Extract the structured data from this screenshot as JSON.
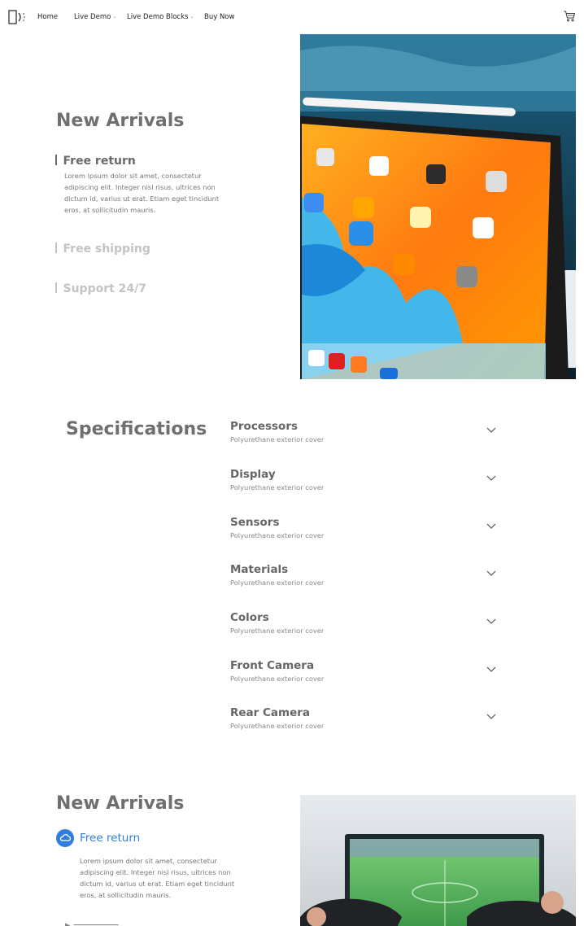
{
  "nav": {
    "items": [
      {
        "label": "Home"
      },
      {
        "label": "Live Demo"
      },
      {
        "label": "Live Demo Blocks"
      },
      {
        "label": "Buy Now"
      }
    ],
    "chevron": "⌄"
  },
  "hero1": {
    "title": "New Arrivals",
    "features": [
      {
        "label": "Free return"
      },
      {
        "label": "Free shipping"
      },
      {
        "label": "Support 24/7"
      }
    ],
    "description": "Lorem ipsum dolor sit amet, consectetur adipiscing elit. Integer nisl risus, ultrices non dictum id, varius ut erat. Etiam eget tincidunt eros, at sollicitudin mauris.",
    "active_feature_index": 0
  },
  "specs": {
    "title": "Specifications",
    "items": [
      {
        "title": "Processors",
        "subtitle": "Polyurethane exterior cover"
      },
      {
        "title": "Display",
        "subtitle": "Polyurethane exterior cover"
      },
      {
        "title": "Sensors",
        "subtitle": "Polyurethane exterior cover"
      },
      {
        "title": "Materials",
        "subtitle": "Polyurethane exterior cover"
      },
      {
        "title": "Colors",
        "subtitle": "Polyurethane exterior cover"
      },
      {
        "title": "Front Camera",
        "subtitle": "Polyurethane exterior cover"
      },
      {
        "title": "Rear Camera",
        "subtitle": "Polyurethane exterior cover"
      }
    ]
  },
  "hero2": {
    "title": "New Arrivals",
    "feature_label": "Free return",
    "description": "Lorem ipsum dolor sit amet, consectetur adipiscing elit. Integer nisl risus, ultrices non dictum id, varius ut erat. Etiam eget tincidunt eros, at sollicitudin mauris.",
    "accent_color": "#2f7de1"
  },
  "icons": {
    "logo": "logo-icon",
    "cart": "cart-icon",
    "chevron": "chevron-down-icon",
    "cloud": "cloud-icon"
  }
}
